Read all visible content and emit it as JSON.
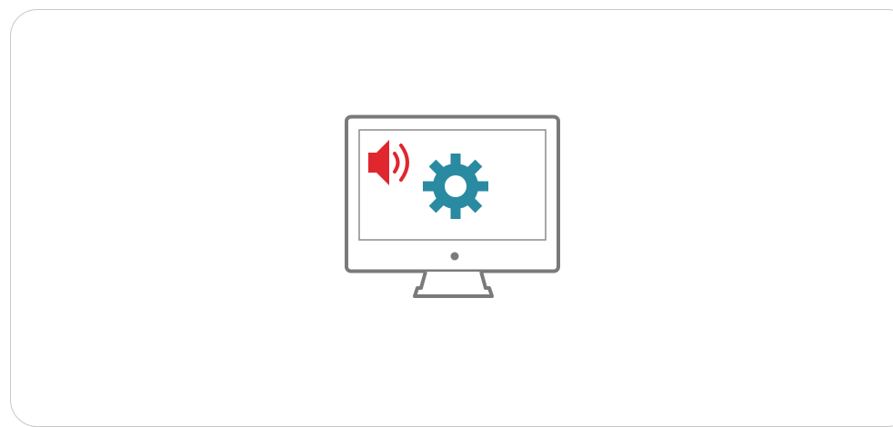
{
  "illustration": {
    "icons": [
      "monitor-icon",
      "speaker-icon",
      "sound-waves-icon",
      "gear-icon",
      "power-dot-icon"
    ],
    "colors": {
      "monitor_stroke": "#7a7a7a",
      "screen_border": "#8a8a8a",
      "speaker": "#e0262e",
      "gear": "#2a8aa1",
      "card_border": "#c8c8c8",
      "background": "#ffffff"
    }
  }
}
